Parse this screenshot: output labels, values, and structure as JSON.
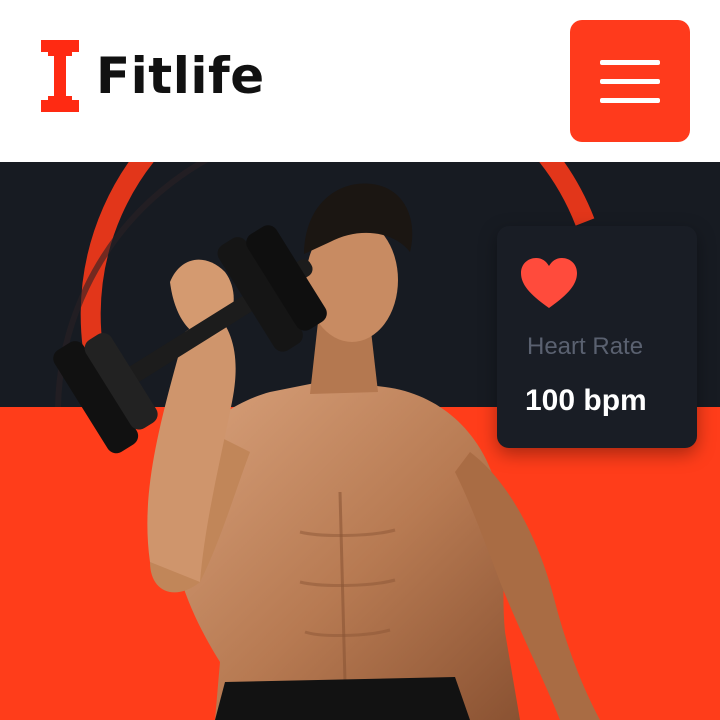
{
  "header": {
    "brand": "Fitlife",
    "logo_icon": "dumbbell-icon",
    "menu_icon": "hamburger-menu-icon"
  },
  "hero": {
    "image": "muscular man lifting dumbbell",
    "heart_rate_card": {
      "icon": "heart-icon",
      "label": "Heart Rate",
      "value": "100 bpm"
    }
  },
  "colors": {
    "accent": "#ff3a1c",
    "dark": "#191d25",
    "brand_text": "#111111"
  }
}
